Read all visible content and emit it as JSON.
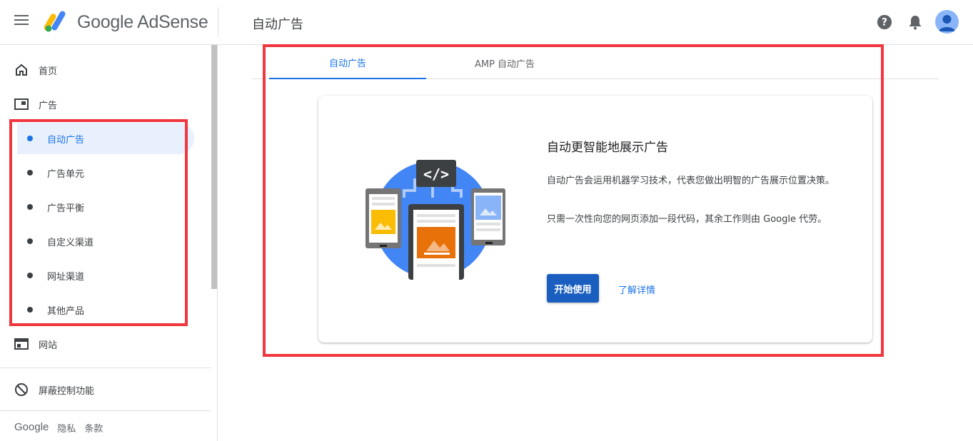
{
  "header": {
    "brand": "Google AdSense",
    "page_title": "自动广告",
    "icons": [
      "menu-icon",
      "help-icon",
      "bell-icon",
      "avatar"
    ]
  },
  "sidebar": {
    "home": "首页",
    "ads": "广告",
    "ads_sub": [
      {
        "label": "自动广告",
        "active": true
      },
      {
        "label": "广告单元",
        "active": false
      },
      {
        "label": "广告平衡",
        "active": false
      },
      {
        "label": "自定义渠道",
        "active": false
      },
      {
        "label": "网址渠道",
        "active": false
      },
      {
        "label": "其他产品",
        "active": false
      }
    ],
    "sites": "网站",
    "blocking": "屏蔽控制功能",
    "footer": {
      "google": "Google",
      "privacy": "隐私",
      "terms": "条款"
    }
  },
  "tabs": [
    {
      "label": "自动广告",
      "active": true
    },
    {
      "label": "AMP 自动广告",
      "active": false
    }
  ],
  "card": {
    "title": "自动更智能地展示广告",
    "p1": "自动广告会运用机器学习技术，代表您做出明智的广告展示位置决策。",
    "p2": "只需一次性向您的网页添加一段代码，其余工作则由 Google 代劳。",
    "start_button": "开始使用",
    "learn_more": "了解详情",
    "code_badge": "</>"
  },
  "colors": {
    "accent": "#1a73e8",
    "highlight": "#f0363e",
    "button": "#1a5fc0"
  }
}
